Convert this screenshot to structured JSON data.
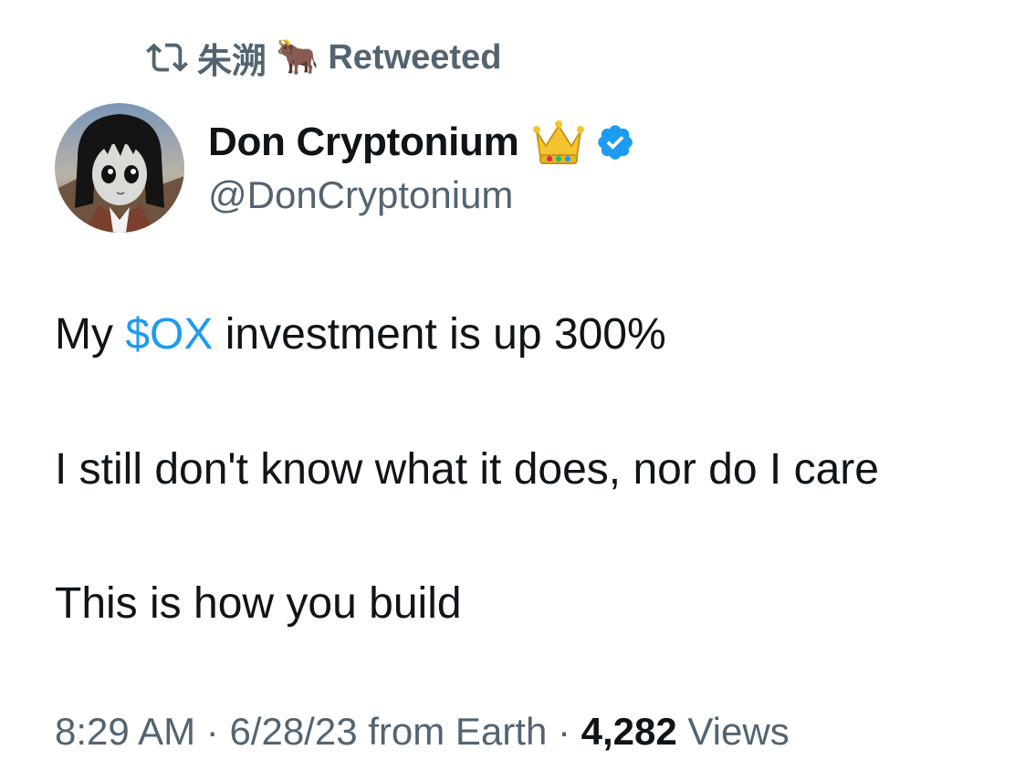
{
  "retweet": {
    "icon": "retweet-icon",
    "name": "朱溯",
    "emoji": "🐂",
    "label": "Retweeted"
  },
  "author": {
    "display_name": "Don Cryptonium",
    "emoji": "👑",
    "verified_icon": "verified-badge-icon",
    "verified_color": "#1d9bf0",
    "handle": "@DonCryptonium"
  },
  "tweet": {
    "line1_prefix": "My ",
    "cashtag": "$OX",
    "line1_suffix": " investment is up 300%",
    "line2": "I still don't know what it does, nor do I care",
    "line3": "This is how you build"
  },
  "meta": {
    "time": "8:29 AM",
    "separator1": " · ",
    "date": "6/28/23",
    "source": " from Earth",
    "separator2": " · ",
    "views_count": "4,282",
    "views_label": " Views"
  },
  "colors": {
    "text": "#0f1419",
    "secondary": "#536471",
    "link": "#1d9bf0"
  }
}
